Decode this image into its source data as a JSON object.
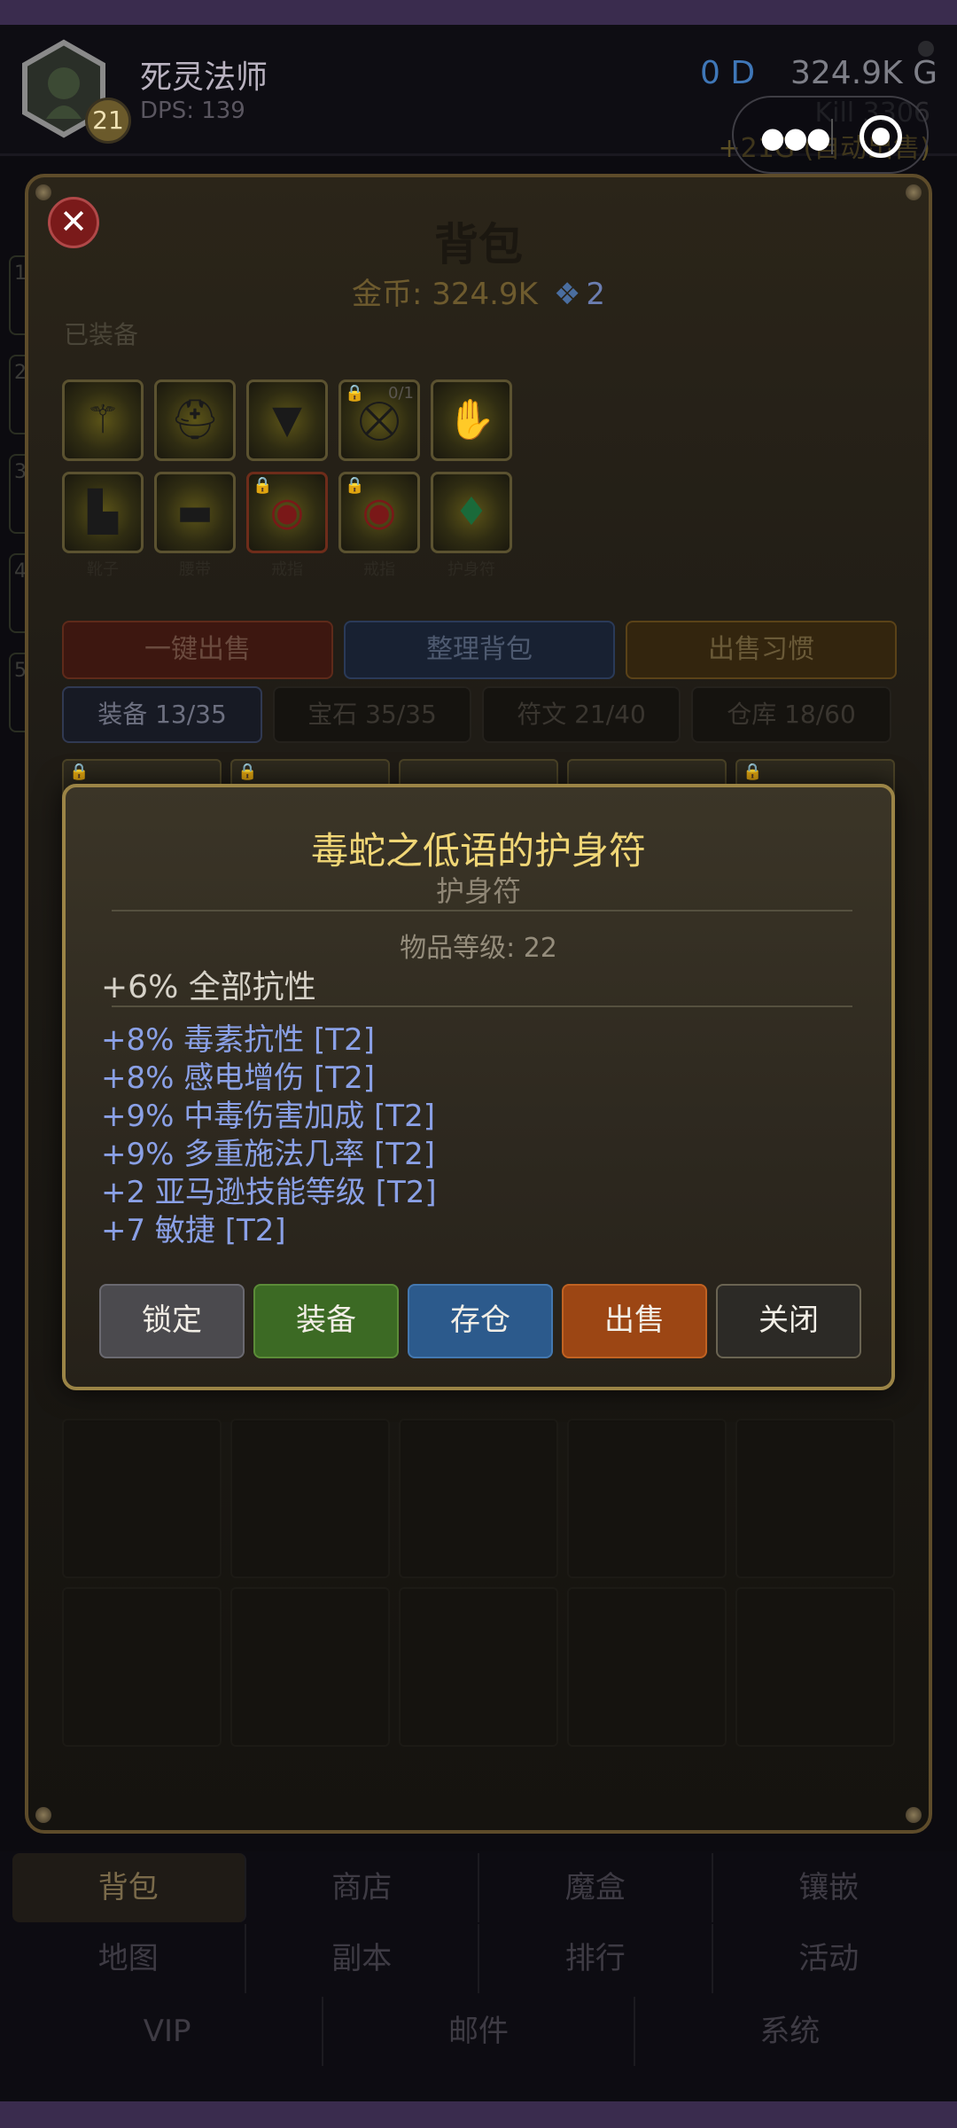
{
  "header": {
    "hero_name": "死灵法师",
    "dps": "DPS: 139",
    "level": "21",
    "currency_d": "0 D",
    "currency_g": "324.9K G",
    "kill_text": "Kill 3306",
    "gain_text": "+21G (自动出售)"
  },
  "side_stubs": [
    "1",
    "2",
    "3",
    "4",
    "5"
  ],
  "panel": {
    "title": "背包",
    "gold_label": "金币: 324.9K",
    "gem_count": "2",
    "equipped_label": "已装备",
    "equipped_row1": [
      {
        "icon": "staff",
        "locked": false,
        "count": ""
      },
      {
        "icon": "helmet",
        "locked": false,
        "count": ""
      },
      {
        "icon": "chest-armor",
        "locked": false,
        "count": ""
      },
      {
        "icon": "shield",
        "locked": true,
        "count": "0/1"
      },
      {
        "icon": "gloves",
        "locked": false,
        "count": ""
      }
    ],
    "equipped_row2": [
      {
        "icon": "boots",
        "locked": false,
        "caption": "靴子"
      },
      {
        "icon": "belt",
        "locked": false,
        "caption": "腰带"
      },
      {
        "icon": "ring",
        "locked": true,
        "caption": "戒指"
      },
      {
        "icon": "ring",
        "locked": true,
        "caption": "戒指"
      },
      {
        "icon": "amulet",
        "locked": false,
        "caption": "护身符"
      }
    ],
    "actions": {
      "sell_all": "一键出售",
      "sort": "整理背包",
      "sell_habit": "出售习惯"
    },
    "tabs": [
      {
        "label": "装备 13/35",
        "active": true
      },
      {
        "label": "宝石 35/35",
        "active": false
      },
      {
        "label": "符文 21/40",
        "active": false
      },
      {
        "label": "仓库 18/60",
        "active": false
      }
    ]
  },
  "tooltip": {
    "name": "毒蛇之低语的护身符",
    "type": "护身符",
    "item_level": "物品等级: 22",
    "implicit": "+6% 全部抗性",
    "affixes": [
      "+8% 毒素抗性 [T2]",
      "+8% 感电增伤 [T2]",
      "+9% 中毒伤害加成 [T2]",
      "+9% 多重施法几率 [T2]",
      "+2 亚马逊技能等级 [T2]",
      "+7 敏捷 [T2]"
    ],
    "buttons": {
      "lock": "锁定",
      "equip": "装备",
      "store": "存仓",
      "sell": "出售",
      "close": "关闭"
    }
  },
  "bottom_nav": {
    "row1": [
      "背包",
      "商店",
      "魔盒",
      "镶嵌"
    ],
    "row2": [
      "地图",
      "副本",
      "排行",
      "活动"
    ],
    "row3": [
      "VIP",
      "邮件",
      "系统"
    ]
  },
  "colors": {
    "gold": "#f0d676",
    "affix_blue": "#8aa0e6",
    "panel_border": "#9b8446"
  }
}
